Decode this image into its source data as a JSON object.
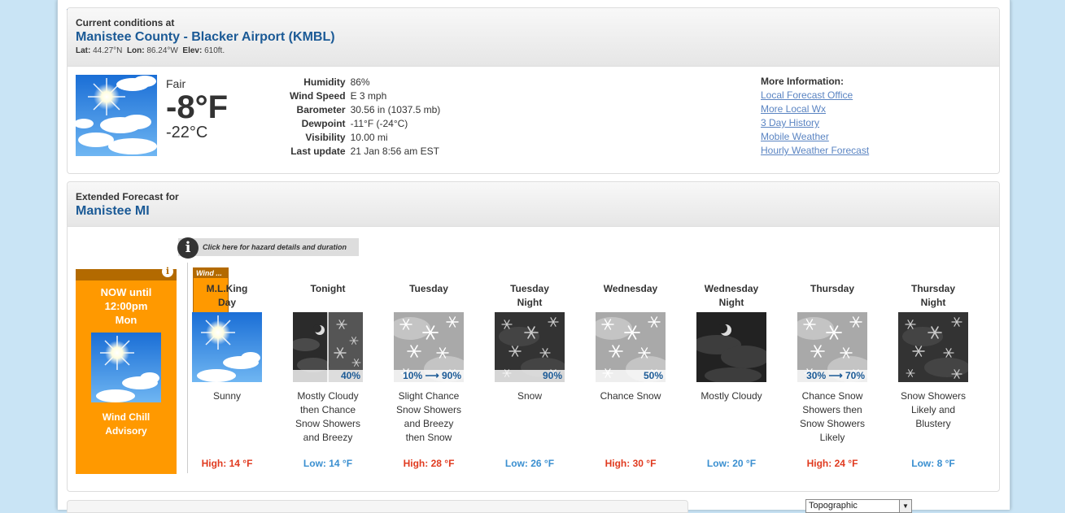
{
  "current": {
    "header_label": "Current conditions at",
    "station": "Manistee County - Blacker Airport (KMBL)",
    "lat_label": "Lat:",
    "lat": "44.27°N",
    "lon_label": "Lon:",
    "lon": "86.24°W",
    "elev_label": "Elev:",
    "elev": "610ft.",
    "condition": "Fair",
    "temp_f": "-8°F",
    "temp_c": "-22°C",
    "details": [
      {
        "label": "Humidity",
        "value": "86%"
      },
      {
        "label": "Wind Speed",
        "value": "E 3 mph"
      },
      {
        "label": "Barometer",
        "value": "30.56 in (1037.5 mb)"
      },
      {
        "label": "Dewpoint",
        "value": "-11°F (-24°C)"
      },
      {
        "label": "Visibility",
        "value": "10.00 mi"
      },
      {
        "label": "Last update",
        "value": "21 Jan 8:56 am EST"
      }
    ],
    "more_title": "More Information:",
    "more_links": [
      "Local Forecast Office",
      "More Local Wx",
      "3 Day History",
      "Mobile Weather",
      "Hourly Weather Forecast"
    ]
  },
  "forecast": {
    "header_label": "Extended Forecast for",
    "location": "Manistee MI",
    "hazard_button": "Click here for hazard details and duration",
    "info_glyph": "i",
    "now": {
      "title_lines": [
        "NOW until",
        "12:00pm",
        "Mon"
      ],
      "advisory_lines": [
        "Wind Chill",
        "Advisory"
      ],
      "info_glyph": "i"
    },
    "wind_tag": "Wind ...",
    "periods": [
      {
        "name": [
          "M.L.King",
          "Day"
        ],
        "icon": "sunny-icon",
        "pop": "",
        "desc": [
          "Sunny"
        ],
        "temp_label": "High: 14 °F",
        "temp_type": "hi"
      },
      {
        "name": [
          "Tonight",
          ""
        ],
        "icon": "mostly-cloudy-night-snow-icon",
        "pop": "40%",
        "desc": [
          "Mostly Cloudy",
          "then Chance",
          "Snow Showers",
          "and Breezy"
        ],
        "temp_label": "Low: 14 °F",
        "temp_type": "lo"
      },
      {
        "name": [
          "Tuesday",
          ""
        ],
        "icon": "snow-icon",
        "pop": "10% ⟶ 90%",
        "desc": [
          "Slight Chance",
          "Snow Showers",
          "and Breezy",
          "then Snow"
        ],
        "temp_label": "High: 28 °F",
        "temp_type": "hi"
      },
      {
        "name": [
          "Tuesday",
          "Night"
        ],
        "icon": "snow-night-icon",
        "pop": "90%",
        "desc": [
          "Snow"
        ],
        "temp_label": "Low: 26 °F",
        "temp_type": "lo"
      },
      {
        "name": [
          "Wednesday",
          ""
        ],
        "icon": "chance-snow-icon",
        "pop": "50%",
        "desc": [
          "Chance Snow"
        ],
        "temp_label": "High: 30 °F",
        "temp_type": "hi"
      },
      {
        "name": [
          "Wednesday",
          "Night"
        ],
        "icon": "mostly-cloudy-night-icon",
        "pop": "",
        "desc": [
          "Mostly Cloudy"
        ],
        "temp_label": "Low: 20 °F",
        "temp_type": "lo"
      },
      {
        "name": [
          "Thursday",
          ""
        ],
        "icon": "snow-showers-icon",
        "pop": "30% ⟶ 70%",
        "desc": [
          "Chance Snow",
          "Showers then",
          "Snow Showers",
          "Likely"
        ],
        "temp_label": "High: 24 °F",
        "temp_type": "hi"
      },
      {
        "name": [
          "Thursday",
          "Night"
        ],
        "icon": "snow-showers-night-icon",
        "pop": "",
        "desc": [
          "Snow Showers",
          "Likely and",
          "Blustery"
        ],
        "temp_label": "Low: 8 °F",
        "temp_type": "lo"
      }
    ]
  },
  "map_select": {
    "value": "Topographic",
    "arrow": "▼"
  }
}
